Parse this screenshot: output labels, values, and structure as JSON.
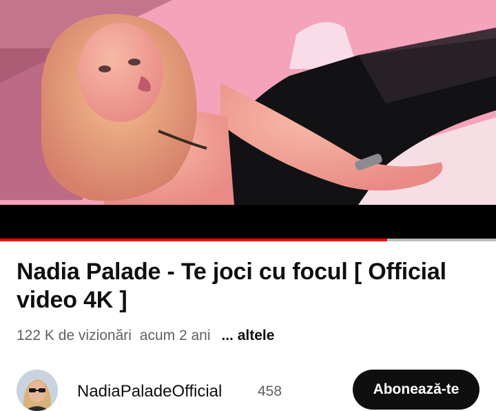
{
  "video": {
    "progress_fraction": 0.78
  },
  "title": "Nadia Palade - Te joci cu focul [ Official video 4K ]",
  "meta": {
    "views": "122 K de vizionări",
    "age": "acum 2 ani",
    "more": "... altele"
  },
  "channel": {
    "name": "NadiaPaladeOfficial",
    "subscribers": "458",
    "subscribe_label": "Abonează-te"
  },
  "colors": {
    "progress": "#ff0000",
    "subscribe_bg": "#0f0f0f"
  }
}
